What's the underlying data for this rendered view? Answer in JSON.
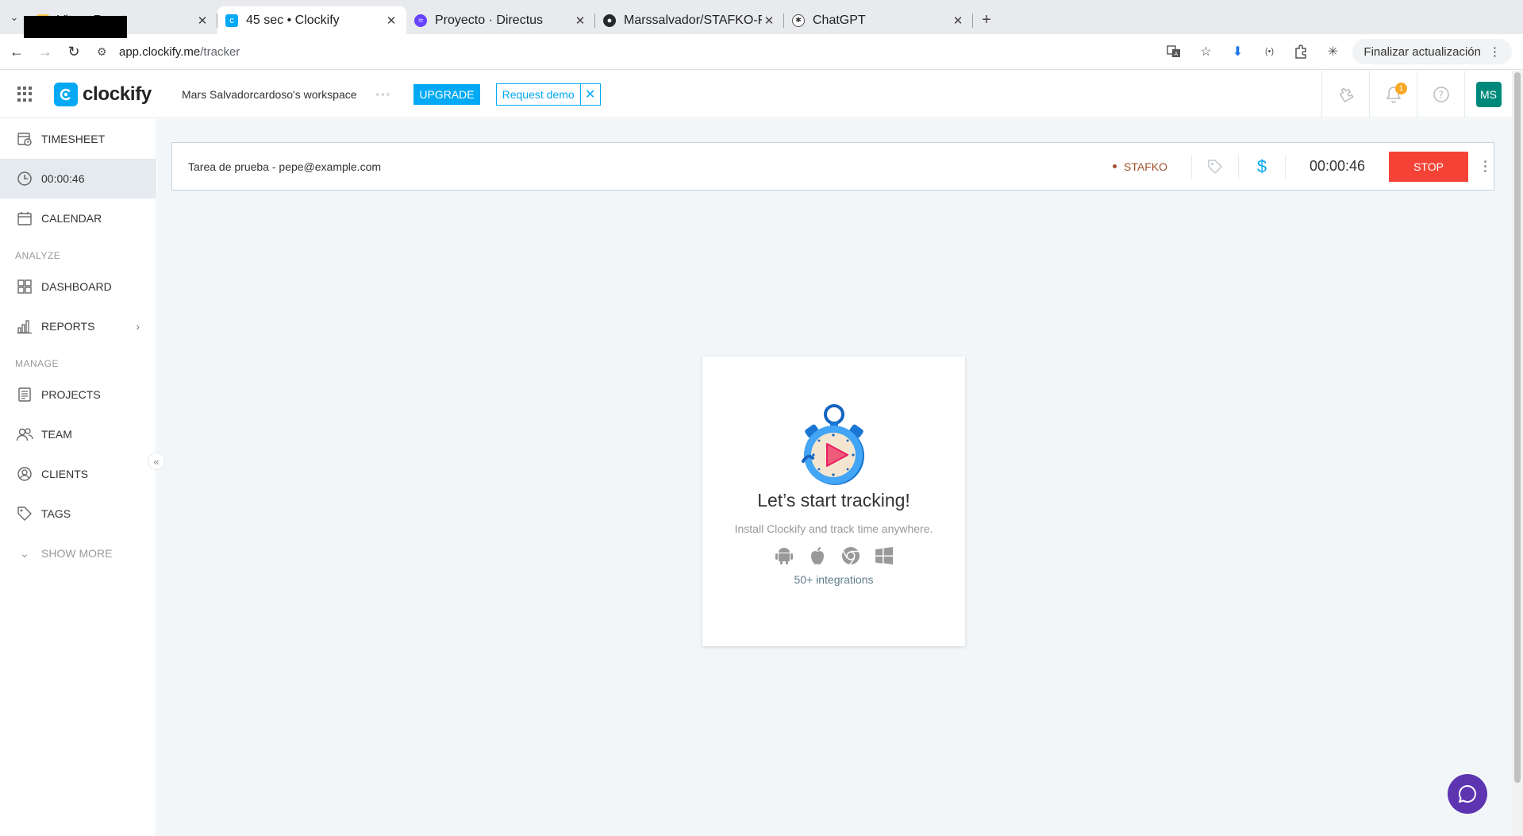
{
  "browser": {
    "tabs": [
      {
        "title": "Vite + React",
        "active": false,
        "favicon": "vite-icon"
      },
      {
        "title": "45 sec • Clockify",
        "active": true,
        "favicon": "clockify-icon"
      },
      {
        "title": "Proyecto · Directus",
        "active": false,
        "favicon": "directus-icon"
      },
      {
        "title": "Marssalvador/STAFKO-F",
        "active": false,
        "favicon": "github-icon"
      },
      {
        "title": "ChatGPT",
        "active": false,
        "favicon": "chatgpt-icon"
      }
    ],
    "url_domain": "app.clockify.me",
    "url_path": "/tracker",
    "update_button": "Finalizar actualización"
  },
  "header": {
    "logo_text": "clockify",
    "workspace": "Mars Salvadorcardoso's workspace",
    "upgrade": "UPGRADE",
    "request_demo": "Request demo",
    "notification_count": "1",
    "avatar_initials": "MS"
  },
  "sidebar": {
    "items": [
      {
        "label": "TIMESHEET",
        "icon": "timesheet-icon"
      },
      {
        "label": "00:00:46",
        "icon": "clock-icon"
      },
      {
        "label": "CALENDAR",
        "icon": "calendar-icon"
      }
    ],
    "analyze_label": "ANALYZE",
    "analyze_items": [
      {
        "label": "DASHBOARD",
        "icon": "dashboard-icon"
      },
      {
        "label": "REPORTS",
        "icon": "reports-icon"
      }
    ],
    "manage_label": "MANAGE",
    "manage_items": [
      {
        "label": "PROJECTS",
        "icon": "projects-icon"
      },
      {
        "label": "TEAM",
        "icon": "team-icon"
      },
      {
        "label": "CLIENTS",
        "icon": "clients-icon"
      },
      {
        "label": "TAGS",
        "icon": "tag-icon"
      }
    ],
    "show_more": "SHOW MORE"
  },
  "timer": {
    "description": "Tarea de prueba - pepe@example.com",
    "project": "STAFKO",
    "project_color": "#a0522d",
    "elapsed": "00:00:46",
    "stop": "STOP",
    "billable_symbol": "$"
  },
  "empty_state": {
    "title": "Let’s start tracking!",
    "subtitle": "Install Clockify and track time anywhere.",
    "platforms": [
      "android-icon",
      "apple-icon",
      "chrome-icon",
      "windows-icon"
    ],
    "integrations": "50+ integrations"
  },
  "colors": {
    "accent": "#03a9f4",
    "stop": "#f44336",
    "avatar": "#00897b",
    "chat": "#5e35b1"
  }
}
